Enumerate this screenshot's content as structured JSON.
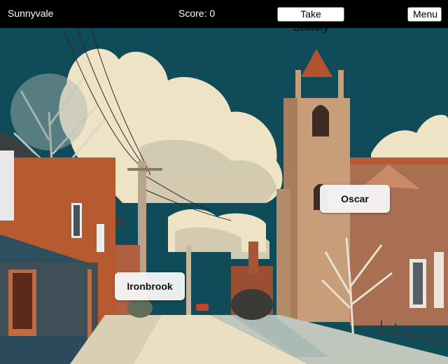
{
  "hud": {
    "town_name": "Sunnyvale",
    "score_label": "Score:",
    "score_value": "0",
    "take_delivery_label": "Take Delivery",
    "menu_label": "Menu"
  },
  "locations": [
    {
      "name": "Oscar"
    },
    {
      "name": "Ironbrook"
    }
  ],
  "colors": {
    "sky": "#0f4b58",
    "cloud": "#efe3c6",
    "brick": "#b85a2f",
    "church_stone": "#c79d7a",
    "road": "#e9dfc4",
    "hud_bg": "#000000"
  }
}
